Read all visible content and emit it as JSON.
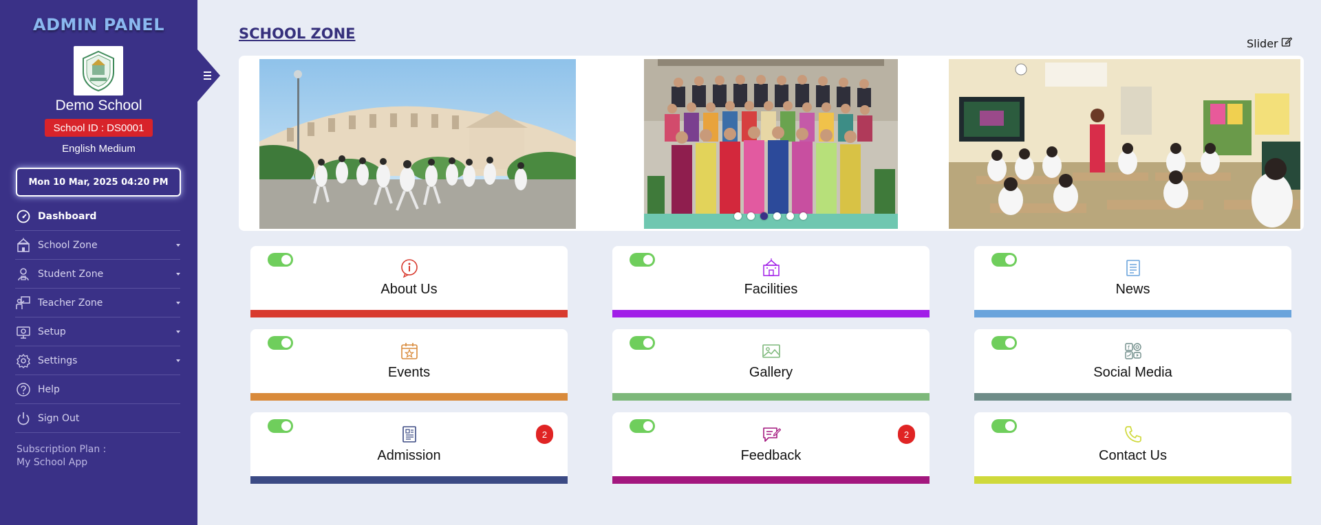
{
  "sidebar": {
    "panel_title": "ADMIN PANEL",
    "school_name": "Demo School",
    "school_id": "School ID : DS0001",
    "medium": "English Medium",
    "datetime": "Mon 10 Mar, 2025 04:20 PM",
    "nav": [
      {
        "label": "Dashboard",
        "icon": "dashboard-icon",
        "active": true
      },
      {
        "label": "School Zone",
        "icon": "school-icon",
        "has_submenu": true
      },
      {
        "label": "Student Zone",
        "icon": "student-icon",
        "has_submenu": true
      },
      {
        "label": "Teacher Zone",
        "icon": "teacher-icon",
        "has_submenu": true
      },
      {
        "label": "Setup",
        "icon": "setup-icon",
        "has_submenu": true
      },
      {
        "label": "Settings",
        "icon": "gear-icon",
        "has_submenu": true
      },
      {
        "label": "Help",
        "icon": "help-icon"
      },
      {
        "label": "Sign Out",
        "icon": "power-icon"
      }
    ],
    "subscription_label": "Subscription Plan :",
    "subscription_value": "My School App"
  },
  "main": {
    "title": "SCHOOL ZONE",
    "slider_link": "Slider",
    "slider": {
      "slide_count": 6,
      "active_slide": 3
    }
  },
  "cards": [
    {
      "title": "About Us",
      "icon": "info-icon",
      "color": "#d83a2e",
      "enabled": true
    },
    {
      "title": "Facilities",
      "icon": "school-building-icon",
      "color": "#a11ee8",
      "enabled": true
    },
    {
      "title": "News",
      "icon": "newspaper-icon",
      "color": "#6aa4dc",
      "enabled": true
    },
    {
      "title": "Events",
      "icon": "calendar-star-icon",
      "color": "#d98a3a",
      "enabled": true
    },
    {
      "title": "Gallery",
      "icon": "image-icon",
      "color": "#7db87a",
      "enabled": true
    },
    {
      "title": "Social Media",
      "icon": "social-media-icon",
      "color": "#6e8c88",
      "enabled": true
    },
    {
      "title": "Admission",
      "icon": "admission-form-icon",
      "color": "#3b4a84",
      "enabled": true,
      "badge": "2"
    },
    {
      "title": "Feedback",
      "icon": "feedback-icon",
      "color": "#a3177e",
      "enabled": true,
      "badge": "2"
    },
    {
      "title": "Contact Us",
      "icon": "phone-icon",
      "color": "#cfd93b",
      "enabled": true
    }
  ]
}
